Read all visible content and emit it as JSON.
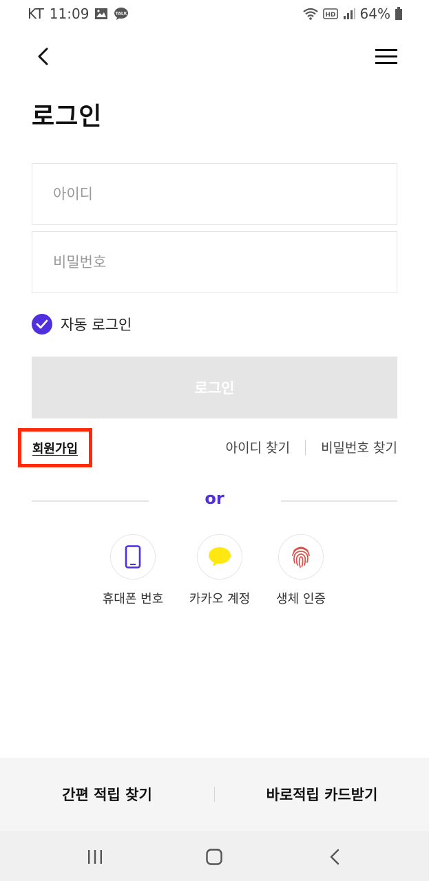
{
  "status_bar": {
    "carrier": "KT",
    "time": "11:09",
    "battery": "64%",
    "icons": [
      "gallery-icon",
      "kakaotalk-icon",
      "wifi-icon",
      "hd-icon",
      "signal-icon",
      "battery-icon"
    ]
  },
  "header": {
    "title": "로그인",
    "back_icon": "chevron-left-icon",
    "menu_icon": "hamburger-menu-icon"
  },
  "form": {
    "id_placeholder": "아이디",
    "password_placeholder": "비밀번호",
    "auto_login_label": "자동 로그인",
    "auto_login_checked": true,
    "login_button": "로그인"
  },
  "links": {
    "signup": "회원가입",
    "find_id": "아이디 찾기",
    "find_password": "비밀번호 찾기"
  },
  "divider": {
    "text": "or"
  },
  "social_login": [
    {
      "label": "휴대폰 번호",
      "icon": "phone-icon"
    },
    {
      "label": "카카오 계정",
      "icon": "kakao-chat-bubble-icon"
    },
    {
      "label": "생체 인증",
      "icon": "fingerprint-icon"
    }
  ],
  "bottom_bar": {
    "left": "간편 적립 찾기",
    "right": "바로적립 카드받기"
  },
  "colors": {
    "accent": "#4f2fde",
    "highlight_border": "#ff2a0a",
    "login_button_disabled": "#e5e5e5",
    "kakao_yellow": "#ffe812",
    "fingerprint_red": "#e0524a"
  }
}
